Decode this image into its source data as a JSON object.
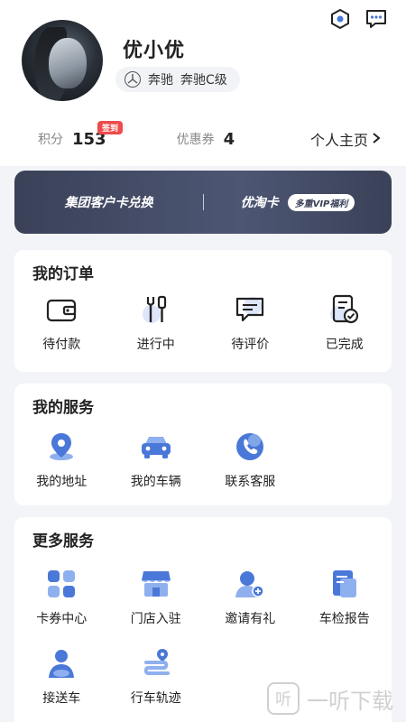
{
  "profile": {
    "name": "优小优",
    "car_brand": "奔驰",
    "car_model": "奔驰C级"
  },
  "stats": {
    "points_label": "积分",
    "points_value": "153",
    "signin_badge": "签到",
    "coupon_label": "优惠券",
    "coupon_value": "4",
    "homepage_label": "个人主页"
  },
  "vip": {
    "left_label": "集团客户卡兑换",
    "right_label": "优淘卡",
    "right_pill": "多重VIP福利"
  },
  "orders": {
    "title": "我的订单",
    "items": [
      {
        "label": "待付款",
        "icon": "wallet-icon"
      },
      {
        "label": "进行中",
        "icon": "tools-icon"
      },
      {
        "label": "待评价",
        "icon": "comment-icon"
      },
      {
        "label": "已完成",
        "icon": "completed-doc-icon"
      }
    ]
  },
  "services": {
    "title": "我的服务",
    "items": [
      {
        "label": "我的地址",
        "icon": "location-pin-icon"
      },
      {
        "label": "我的车辆",
        "icon": "car-icon"
      },
      {
        "label": "联系客服",
        "icon": "phone-icon"
      }
    ]
  },
  "more": {
    "title": "更多服务",
    "items": [
      {
        "label": "卡券中心",
        "icon": "grid-icon"
      },
      {
        "label": "门店入驻",
        "icon": "store-icon"
      },
      {
        "label": "邀请有礼",
        "icon": "invite-icon"
      },
      {
        "label": "车检报告",
        "icon": "report-icon"
      },
      {
        "label": "接送车",
        "icon": "driver-icon"
      },
      {
        "label": "行车轨迹",
        "icon": "route-icon"
      }
    ]
  },
  "watermark": {
    "text": "一听下载",
    "glyph": "听"
  },
  "colors": {
    "accent": "#4a78d8",
    "badge": "#ef4b4b",
    "banner": "#3a4158"
  }
}
